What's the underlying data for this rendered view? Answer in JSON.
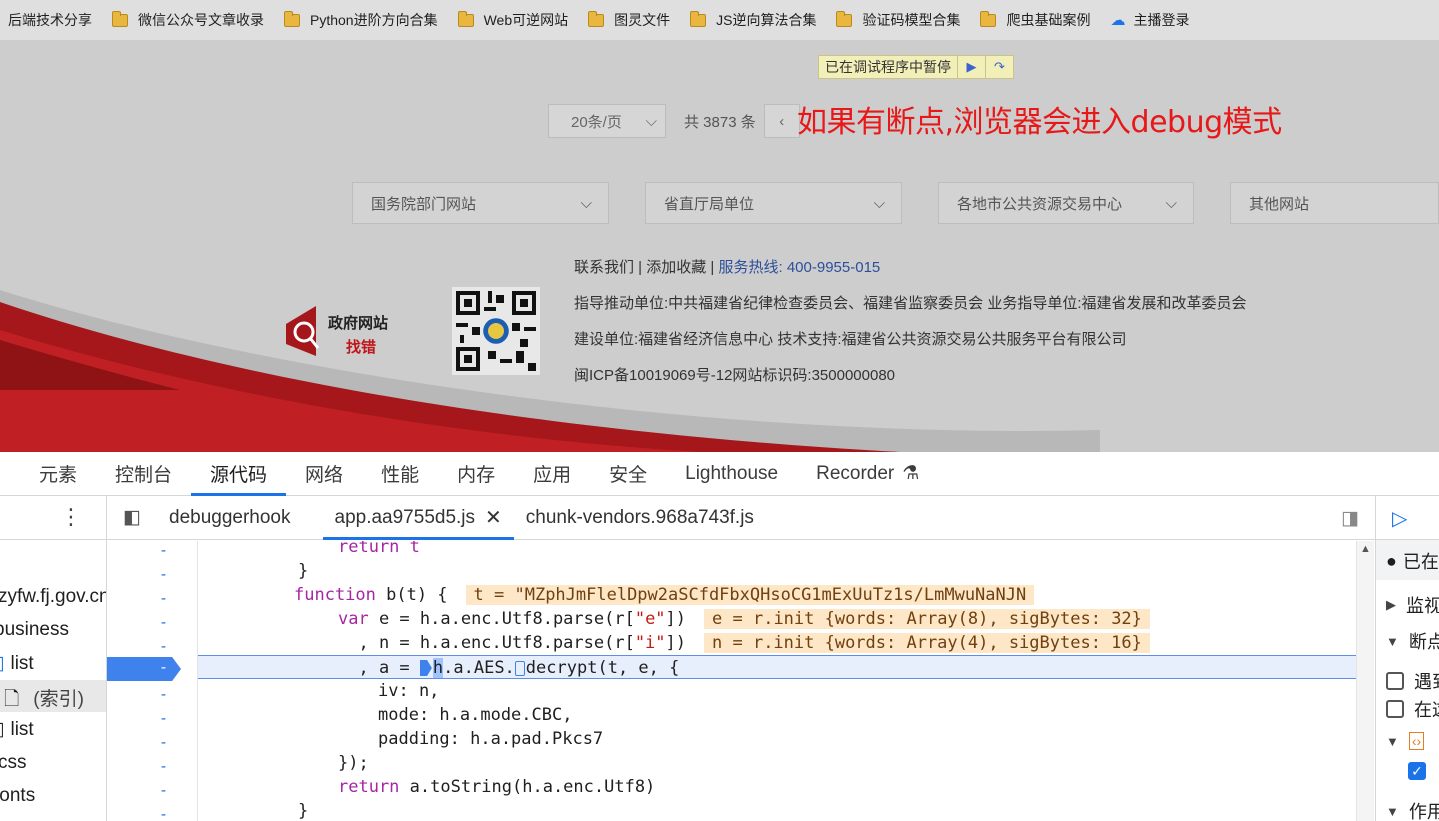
{
  "bookmarks": [
    {
      "label": "后端技术分享",
      "icon": "none"
    },
    {
      "label": "微信公众号文章收录",
      "icon": "folder-icon"
    },
    {
      "label": "Python进阶方向合集",
      "icon": "folder-icon"
    },
    {
      "label": "Web可逆网站",
      "icon": "folder-icon"
    },
    {
      "label": "图灵文件",
      "icon": "folder-icon"
    },
    {
      "label": "JS逆向算法合集",
      "icon": "folder-icon"
    },
    {
      "label": "验证码模型合集",
      "icon": "folder-icon"
    },
    {
      "label": "爬虫基础案例",
      "icon": "folder-icon"
    },
    {
      "label": "主播登录",
      "icon": "cloud-icon"
    }
  ],
  "paused": {
    "label": "已在调试程序中暂停"
  },
  "pager": {
    "page_size": "20条/页",
    "total": "共 3873 条"
  },
  "overlay_note": "如果有断点,浏览器会进入debug模式",
  "site_selects": [
    "国务院部门网站",
    "省直厅局单位",
    "各地市公共资源交易中心",
    "其他网站"
  ],
  "footer": {
    "contact": "联系我们",
    "favorite": "添加收藏",
    "hotline_label": "服务热线:",
    "hotline": "400-9955-015",
    "line2": "指导推动单位:中共福建省纪律检查委员会、福建省监察委员会      业务指导单位:福建省发展和改革委员会",
    "line3": "建设单位:福建省经济信息中心      技术支持:福建省公共资源交易公共服务平台有限公司",
    "line4": "闽ICP备10019069号-12网站标识码:3500000080"
  },
  "gov_logo": {
    "line1": "政府网站",
    "line2": "找错"
  },
  "devtools": {
    "tabs": [
      "元素",
      "控制台",
      "源代码",
      "网络",
      "性能",
      "内存",
      "应用",
      "安全",
      "Lighthouse",
      "Recorder"
    ],
    "active_tab": "源代码",
    "editor_tabs": [
      "debuggerhook",
      "app.aa9755d5.js",
      "chunk-vendors.968a743f.js"
    ],
    "nav_items": [
      "zyfw.fj.gov.cn",
      "business",
      "list",
      "(索引)",
      "list",
      "css",
      "fonts"
    ],
    "debug_rows": [
      "已在",
      "监视",
      "断点",
      "遇到",
      "在这",
      "作用"
    ],
    "code": {
      "l1": "return t",
      "l2": "}",
      "l3_a": "function",
      "l3_b": " b(t) {",
      "l3_val": "t = \"MZphJmFlelDpw2aSCfdFbxQHsoCG1mExUuTz1s/LmMwuNaNJN",
      "l4_a": "var",
      "l4_b": " e = h.a.enc.Utf8.parse(r[",
      "l4_s": "\"e\"",
      "l4_c": "])",
      "l4_val": "e = r.init {words: Array(8), sigBytes: 32}",
      "l5_b": "  , n = h.a.enc.Utf8.parse(r[",
      "l5_s": "\"i\"",
      "l5_c": "])",
      "l5_val": "n = r.init {words: Array(4), sigBytes: 16}",
      "l6_a": "  , a = ",
      "l6_b": "h",
      "l6_c": ".a.AES.",
      "l6_d": "decrypt(",
      "l6_e": "t",
      "l6_f": ", e, {",
      "l7": "iv: n,",
      "l8": "mode: h.a.mode.CBC,",
      "l9": "padding: h.a.pad.Pkcs7",
      "l10": "});",
      "l11_a": "return",
      "l11_b": " a.toString(h.a.enc.Utf8)",
      "l12": "}"
    },
    "gutter_mark": "-"
  }
}
